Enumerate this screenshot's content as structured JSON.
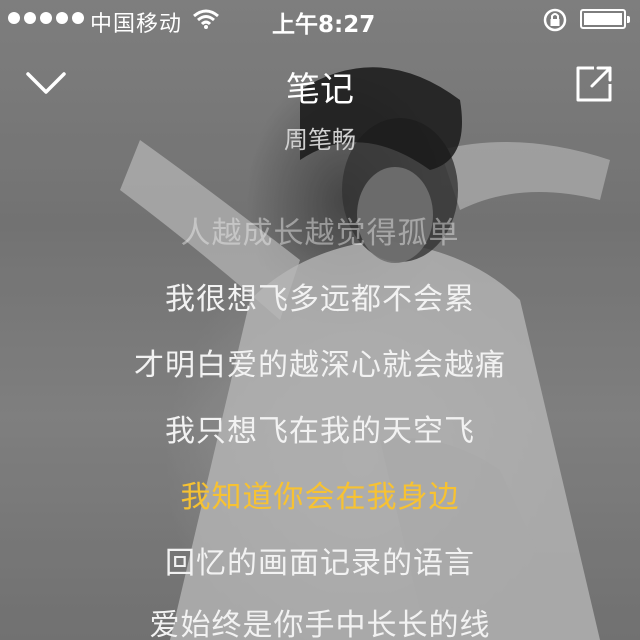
{
  "status_bar": {
    "carrier": "中国移动",
    "time": "上午8:27"
  },
  "player": {
    "title": "笔记",
    "artist": "周笔畅"
  },
  "lyrics": [
    {
      "text": "人越成长越觉得孤单",
      "state": "faded"
    },
    {
      "text": "我很想飞多远都不会累",
      "state": "normal"
    },
    {
      "text": "才明白爱的越深心就会越痛",
      "state": "normal"
    },
    {
      "text": "我只想飞在我的天空飞",
      "state": "normal"
    },
    {
      "text": "我知道你会在我身边",
      "state": "current"
    },
    {
      "text": "回忆的画面记录的语言",
      "state": "normal"
    },
    {
      "text": "爱始终是你手中长长的线",
      "state": "normal"
    }
  ],
  "colors": {
    "highlight": "#f7c232",
    "text": "#f2f2f2"
  },
  "icons": {
    "back": "chevron-down-icon",
    "share": "share-icon"
  }
}
